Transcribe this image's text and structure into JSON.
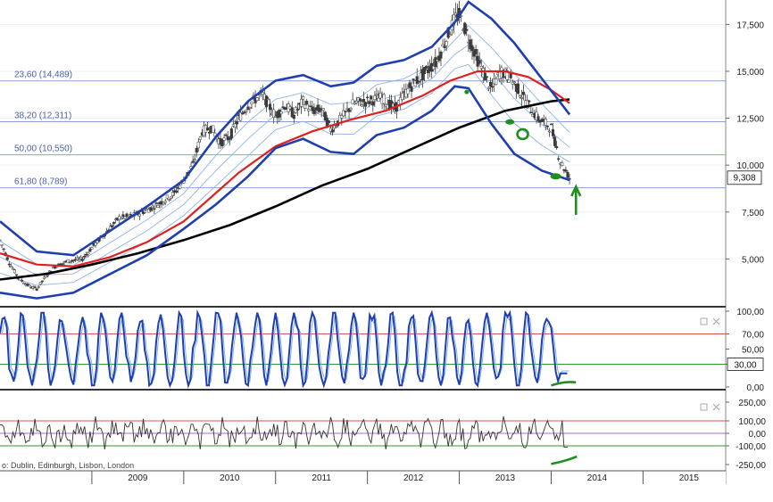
{
  "colors": {
    "background": "#ffffff",
    "price": "#3a3a3a",
    "bollinger": "#1f3fb0",
    "bollinger_inner": "#8fb4e6",
    "ma_red": "#e02020",
    "ma_black": "#000000",
    "fib_line": "#8aa0d8",
    "fib_text": "#4a5fb0",
    "osc_blue": "#1f3fb0",
    "osc_light": "#7fb0e8",
    "level_red": "#e05050",
    "level_green": "#2e9a2e",
    "cci": "#333333",
    "cci_mid": "#a070c0",
    "annotation_green": "#1e8e1e",
    "axis_text": "#222222",
    "divider": "#333333"
  },
  "chart_data": [
    {
      "type": "line",
      "panel": "price",
      "xlim": [
        2008.0,
        2015.9
      ],
      "ylim": [
        2500,
        18800
      ],
      "y_ticks": [
        5000,
        7500,
        10000,
        12500,
        15000,
        17500
      ],
      "y_tick_labels": [
        "5,000",
        "7,500",
        "10,000",
        "12,500",
        "15,000",
        "17,500"
      ],
      "last_value_label": "9,308",
      "fib_levels": [
        {
          "label": "23,60 (14,489)",
          "value": 14489
        },
        {
          "label": "38,20 (12,311)",
          "value": 12311
        },
        {
          "label": "50,00 (10,550)",
          "value": 10550
        },
        {
          "label": "61,80 (8,789)",
          "value": 8789
        }
      ],
      "series": [
        {
          "role": "price",
          "x": [
            2008.0,
            2008.1,
            2008.2,
            2008.3,
            2008.4,
            2008.5,
            2008.6,
            2008.75,
            2008.9,
            2009.0,
            2009.15,
            2009.3,
            2009.45,
            2009.6,
            2009.75,
            2009.9,
            2010.0,
            2010.1,
            2010.2,
            2010.3,
            2010.4,
            2010.5,
            2010.6,
            2010.7,
            2010.85,
            2011.0,
            2011.1,
            2011.2,
            2011.3,
            2011.4,
            2011.5,
            2011.6,
            2011.7,
            2011.85,
            2012.0,
            2012.15,
            2012.3,
            2012.45,
            2012.6,
            2012.75,
            2012.85,
            2012.95,
            2013.0,
            2013.1,
            2013.2,
            2013.35,
            2013.45,
            2013.55,
            2013.7,
            2013.85,
            2014.0,
            2014.1,
            2014.2
          ],
          "y": [
            6000,
            4800,
            4000,
            3600,
            3400,
            4100,
            4600,
            4900,
            5000,
            5600,
            6400,
            7200,
            7300,
            7600,
            8000,
            8500,
            9200,
            10000,
            11800,
            12000,
            11200,
            11500,
            12500,
            13200,
            13800,
            12600,
            13200,
            12700,
            13400,
            12900,
            13000,
            11900,
            12400,
            13300,
            13400,
            13600,
            13000,
            14100,
            14800,
            15500,
            16600,
            17800,
            18000,
            16800,
            15600,
            14000,
            15000,
            14700,
            13600,
            12500,
            12000,
            10200,
            9308
          ]
        },
        {
          "role": "ma_red",
          "x": [
            2008.0,
            2008.4,
            2008.8,
            2009.2,
            2009.6,
            2010.0,
            2010.3,
            2010.6,
            2011.0,
            2011.4,
            2011.8,
            2012.2,
            2012.6,
            2012.9,
            2013.2,
            2013.5,
            2013.75,
            2014.0,
            2014.2
          ],
          "y": [
            5300,
            4700,
            4600,
            5100,
            5900,
            7000,
            8300,
            9600,
            11000,
            11800,
            12400,
            12900,
            13700,
            14500,
            15000,
            15000,
            14700,
            14000,
            13300
          ]
        },
        {
          "role": "ma_black",
          "x": [
            2008.0,
            2008.5,
            2009.0,
            2009.5,
            2010.0,
            2010.5,
            2011.0,
            2011.5,
            2012.0,
            2012.5,
            2013.0,
            2013.5,
            2014.0,
            2014.2
          ],
          "y": [
            3900,
            4200,
            4700,
            5300,
            6000,
            6800,
            7800,
            8900,
            9800,
            10900,
            12000,
            12900,
            13400,
            13500
          ]
        },
        {
          "role": "bb_upper",
          "x": [
            2008.0,
            2008.4,
            2008.8,
            2009.2,
            2009.6,
            2010.0,
            2010.35,
            2010.7,
            2011.0,
            2011.3,
            2011.6,
            2011.85,
            2012.1,
            2012.4,
            2012.7,
            2012.95,
            2013.1,
            2013.35,
            2013.6,
            2013.9,
            2014.2
          ],
          "y": [
            7000,
            5400,
            5200,
            6500,
            7800,
            9200,
            11500,
            13400,
            14500,
            14800,
            14200,
            14400,
            15300,
            15600,
            16300,
            17600,
            18700,
            17800,
            16500,
            14600,
            12700
          ]
        },
        {
          "role": "bb_lower",
          "x": [
            2008.0,
            2008.4,
            2008.8,
            2009.2,
            2009.6,
            2010.0,
            2010.35,
            2010.7,
            2011.0,
            2011.3,
            2011.6,
            2011.85,
            2012.1,
            2012.4,
            2012.7,
            2012.95,
            2013.1,
            2013.35,
            2013.6,
            2013.9,
            2014.2
          ],
          "y": [
            3200,
            2900,
            3200,
            4200,
            5200,
            6600,
            7900,
            9400,
            10900,
            11400,
            10700,
            10600,
            11600,
            12000,
            12900,
            14200,
            14100,
            12200,
            10600,
            9700,
            9200
          ]
        }
      ]
    },
    {
      "type": "line",
      "panel": "oscillator",
      "ylim": [
        0,
        100
      ],
      "y_ticks": [
        0,
        30,
        50,
        70,
        100
      ],
      "y_tick_labels": [
        "0,00",
        "30,00",
        "50,00",
        "70,00",
        "100,00"
      ],
      "levels": [
        70,
        30
      ],
      "last_value_label": "30,00"
    },
    {
      "type": "line",
      "panel": "cci",
      "ylim": [
        -300,
        300
      ],
      "y_ticks": [
        -250,
        -100,
        0,
        100,
        250
      ],
      "y_tick_labels": [
        "-250,00",
        "-100,00",
        "0,00",
        "100,00",
        "250,00"
      ],
      "levels": [
        100,
        0,
        -100
      ]
    }
  ],
  "x_axis": {
    "years": [
      "2009",
      "2010",
      "2011",
      "2012",
      "2013",
      "2014",
      "2015"
    ]
  },
  "source_text": "o: Dublin, Edinburgh, Lisbon, London",
  "panel_icons": [
    "maximize-icon",
    "close-icon"
  ]
}
